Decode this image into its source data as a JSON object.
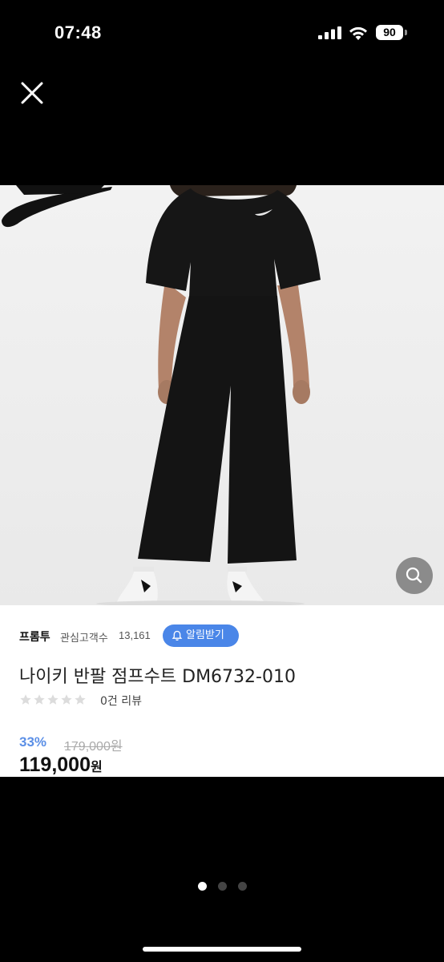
{
  "status_bar": {
    "time": "07:48",
    "battery": "90"
  },
  "store": {
    "brand": "프롬투",
    "followers_label": "관심고객수",
    "followers_count": "13,161",
    "notify_label": "알림받기"
  },
  "product": {
    "title": "나이키 반팔 점프수트 DM6732-010",
    "rating": 0,
    "review_text": "0건 리뷰",
    "discount": "33%",
    "original_price": "179,000원",
    "price_number": "119,000",
    "price_unit": "원"
  },
  "gallery": {
    "count": 3,
    "active_index": 0
  },
  "colors": {
    "accent": "#4a86e8",
    "discount": "#5b8fe6",
    "star": "#dcdcdc"
  },
  "icons": [
    "close-icon",
    "search-icon",
    "bell-plus-icon",
    "star-icon"
  ]
}
